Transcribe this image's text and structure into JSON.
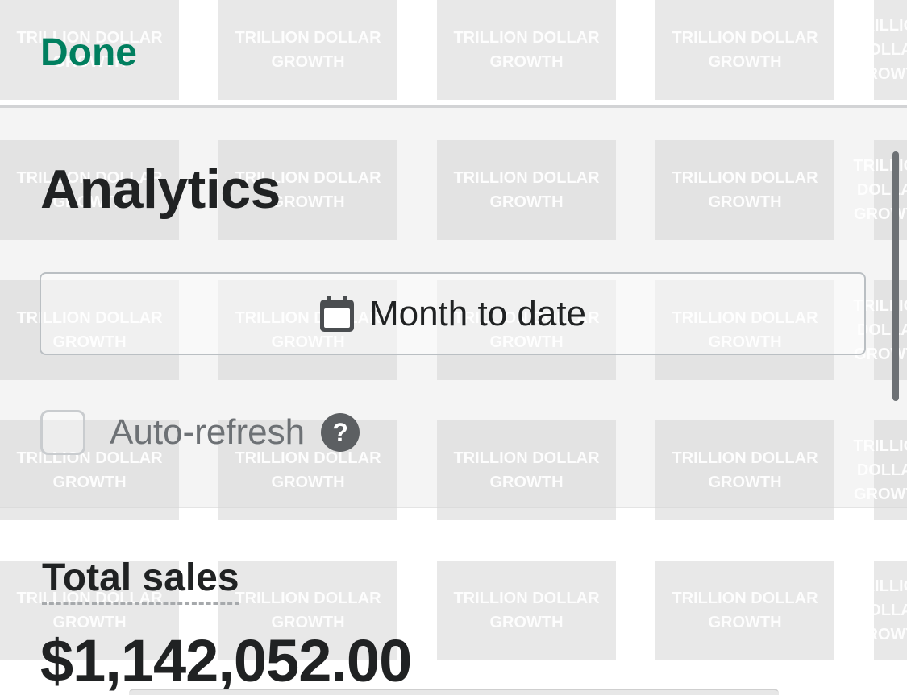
{
  "top_bar": {
    "done_label": "Done"
  },
  "header": {
    "title": "Analytics",
    "date_range_label": "Month to date",
    "date_range_icon": "calendar-icon",
    "auto_refresh": {
      "label": "Auto-refresh",
      "checked": false,
      "help_icon": "question-circle-icon",
      "help_glyph": "?"
    }
  },
  "metrics": {
    "total_sales_label": "Total sales",
    "total_sales_value": "$1,142,052.00"
  },
  "watermark": {
    "line1": "TRILLION DOLLAR",
    "line2": "GROWTH"
  },
  "colors": {
    "accent": "#007f5f",
    "text": "#202223",
    "muted_text": "#6d7175",
    "panel_background": "#f4f4f4",
    "border": "#babfc3"
  }
}
